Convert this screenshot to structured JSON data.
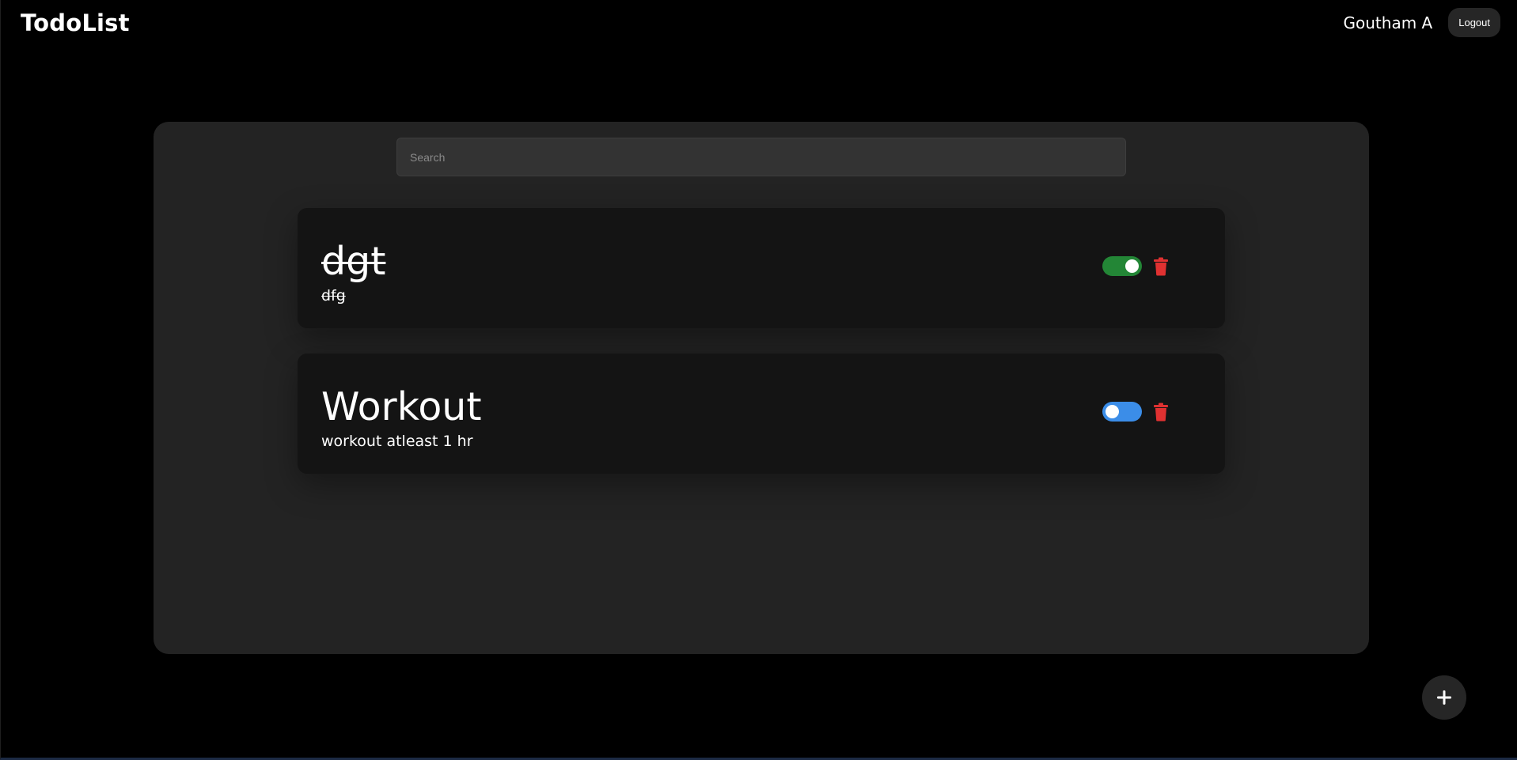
{
  "header": {
    "brand": "TodoList",
    "user_name": "Goutham A",
    "logout_label": "Logout"
  },
  "search": {
    "placeholder": "Search",
    "value": ""
  },
  "todos": [
    {
      "title": "dgt",
      "description": "dfg",
      "completed": true,
      "toggle_color": "#238636"
    },
    {
      "title": "Workout",
      "description": "workout atleast 1 hr",
      "completed": false,
      "toggle_color": "#3b8de8"
    }
  ],
  "icons": {
    "delete": "trash-icon",
    "add": "plus-icon"
  },
  "colors": {
    "background": "#000000",
    "panel": "#232323",
    "card": "#141414",
    "delete": "#e03131",
    "toggle_on": "#238636",
    "toggle_off": "#3b8de8"
  }
}
